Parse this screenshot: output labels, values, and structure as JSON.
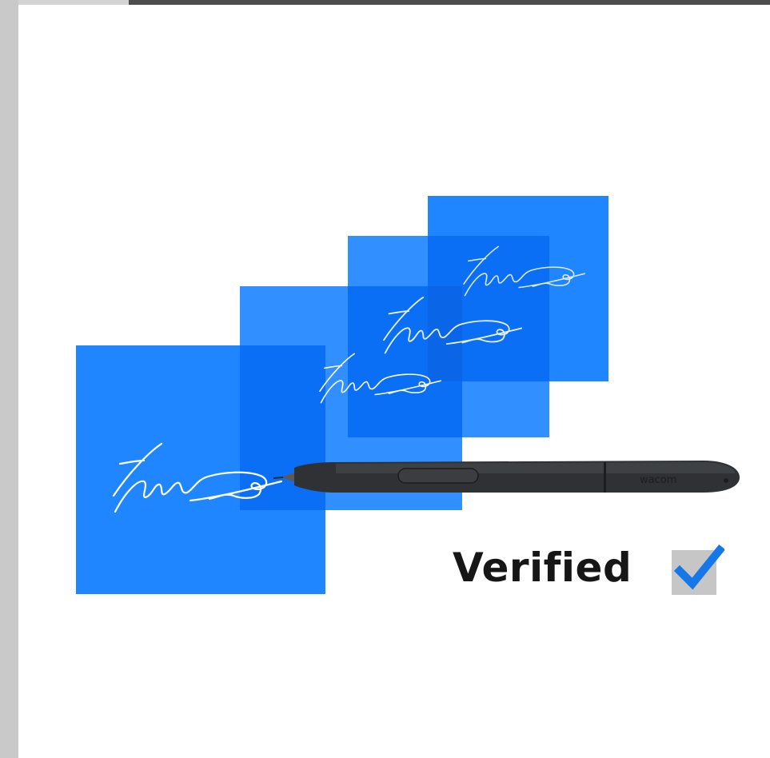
{
  "status": {
    "label": "Verified",
    "check_icon": "checkmark-icon",
    "check_color": "#1577e8",
    "box_color": "#c6c6c6"
  },
  "pen": {
    "brand": "wacom",
    "icon": "stylus-pen-icon"
  },
  "colors": {
    "card_blue": "#1f86ff",
    "card_blue_overlap": "#0b6ff5",
    "ink": "#ffffff",
    "text": "#161616",
    "frame_light": "#c9c9c9",
    "frame_dark": "#4d4d4d"
  }
}
